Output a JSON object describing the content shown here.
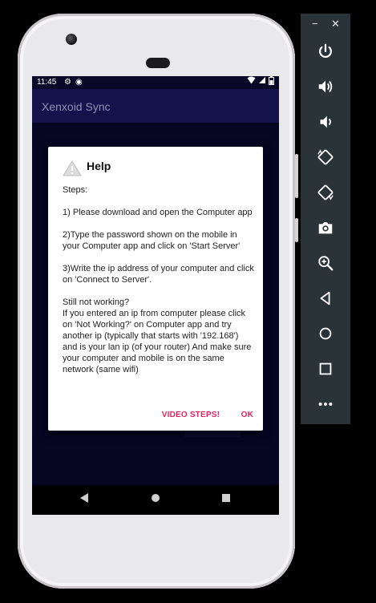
{
  "status_bar": {
    "time": "11:45",
    "gear_icon": "gear-icon",
    "sync_icon": "sync-icon",
    "wifi_icon": "wifi-icon",
    "signal_icon": "signal-icon",
    "battery_icon": "battery-icon"
  },
  "app": {
    "title": "Xenxoid Sync"
  },
  "dialog": {
    "title": "Help",
    "icon": "warning-icon",
    "paragraphs": [
      "Steps:",
      "1) Please download and open the Computer app",
      "2)Type the password shown on the mobile in your Computer app and click on 'Start Server'",
      "3)Write the ip address of your computer and click on 'Connect to Server'.",
      "Still not working?",
      "If you entered an ip from computer please click on 'Not Working?' on Computer app and try another ip (typically that starts with '192.168') and is your lan ip (of your router) And make sure your computer and mobile is on the same network (same wifi)"
    ],
    "video_steps_label": "VIDEO STEPS!",
    "ok_label": "OK",
    "accent_color": "#e0245e"
  },
  "navbar": {
    "back_icon": "back-icon",
    "home_icon": "home-icon",
    "recents_icon": "recents-icon"
  },
  "emulator_toolbar": {
    "minimize_label": "−",
    "close_label": "✕",
    "buttons": [
      "power-icon",
      "volume-up-icon",
      "volume-down-icon",
      "rotate-left-icon",
      "rotate-right-icon",
      "camera-icon",
      "zoom-icon",
      "back-icon",
      "home-icon",
      "overview-icon",
      "more-icon"
    ]
  },
  "colors": {
    "screen_bg": "#0b0a33",
    "appbar_bg": "#14124a",
    "toolbar_bg": "#2a3338"
  }
}
